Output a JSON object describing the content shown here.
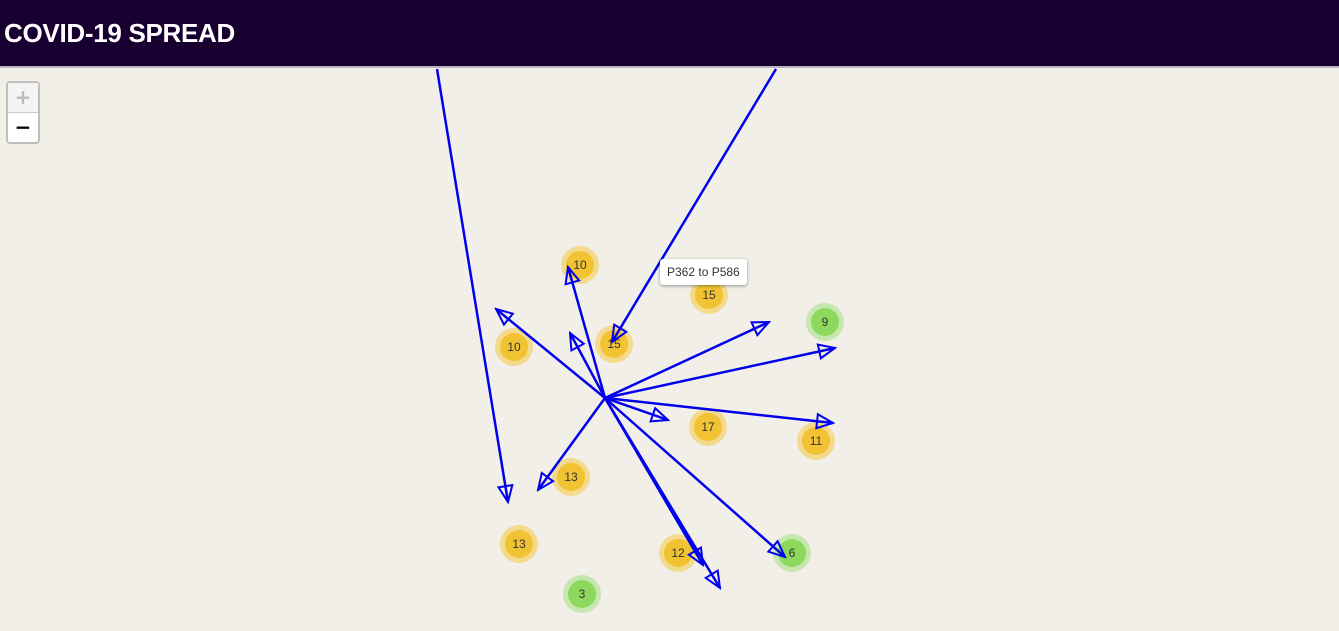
{
  "header": {
    "title": "COVID-19 SPREAD"
  },
  "zoom": {
    "in_label": "+",
    "out_label": "−"
  },
  "tooltip": {
    "text": "P362 to P586"
  },
  "clusters": [
    {
      "count": "10",
      "status": "yellow"
    },
    {
      "count": "15",
      "status": "yellow"
    },
    {
      "count": "9",
      "status": "green"
    },
    {
      "count": "10",
      "status": "yellow"
    },
    {
      "count": "15",
      "status": "yellow"
    },
    {
      "count": "17",
      "status": "yellow"
    },
    {
      "count": "11",
      "status": "yellow"
    },
    {
      "count": "13",
      "status": "yellow"
    },
    {
      "count": "13",
      "status": "yellow"
    },
    {
      "count": "12",
      "status": "yellow"
    },
    {
      "count": "6",
      "status": "green"
    },
    {
      "count": "3",
      "status": "green"
    }
  ],
  "colors": {
    "header_bg": "#17002f",
    "map_bg": "#f2efe9",
    "arrow": "#0000ee",
    "cluster_yellow_inner": "#f1c232",
    "cluster_yellow_outer": "#f3d36e",
    "cluster_green_inner": "#8ed85e",
    "cluster_green_outer": "#b7e49a"
  }
}
